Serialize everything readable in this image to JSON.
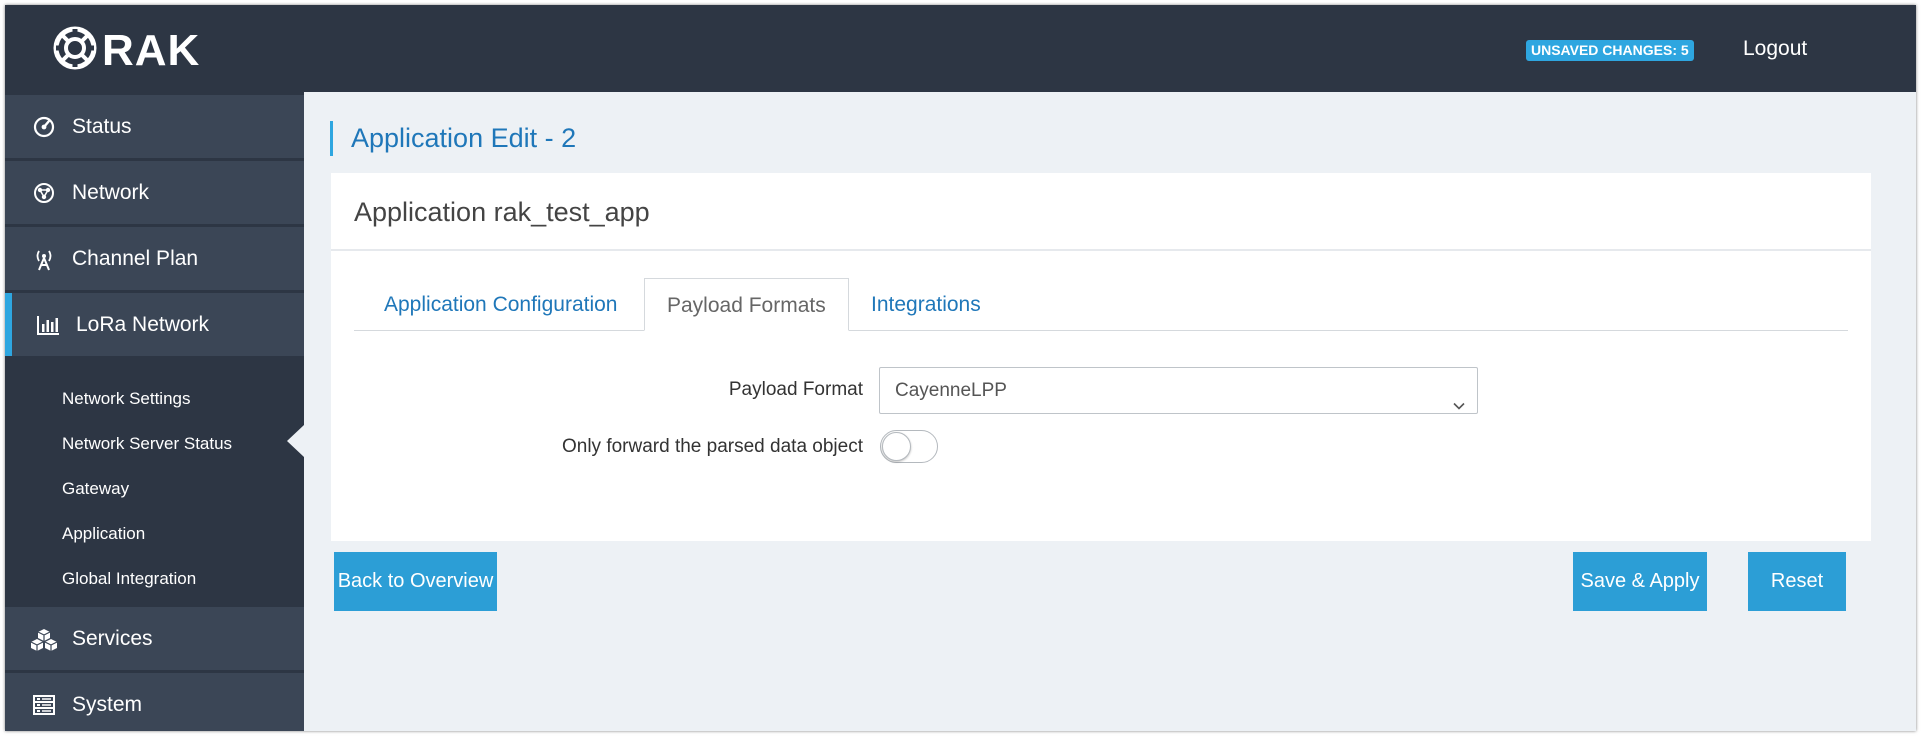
{
  "header": {
    "logo_text": "RAK",
    "unsaved_badge": "UNSAVED CHANGES: 5",
    "logout_label": "Logout"
  },
  "sidebar": {
    "items": [
      {
        "label": "Status",
        "icon": "dashboard-icon"
      },
      {
        "label": "Network",
        "icon": "network-icon"
      },
      {
        "label": "Channel Plan",
        "icon": "antenna-icon"
      },
      {
        "label": "LoRa Network",
        "icon": "bar-chart-icon",
        "active": true
      },
      {
        "label": "Services",
        "icon": "cubes-icon"
      },
      {
        "label": "System",
        "icon": "server-list-icon"
      }
    ],
    "sub_items": [
      {
        "label": "Network Settings"
      },
      {
        "label": "Network Server Status"
      },
      {
        "label": "Gateway"
      },
      {
        "label": "Application",
        "active": true
      },
      {
        "label": "Global Integration"
      }
    ]
  },
  "main": {
    "page_title": "Application Edit - 2",
    "card_title": "Application rak_test_app",
    "tabs": [
      {
        "label": "Application Configuration"
      },
      {
        "label": "Payload Formats",
        "active": true
      },
      {
        "label": "Integrations"
      }
    ],
    "form": {
      "payload_format_label": "Payload Format",
      "payload_format_value": "CayenneLPP",
      "forward_label": "Only forward the parsed data object",
      "forward_enabled": false
    },
    "buttons": {
      "back": "Back to Overview",
      "save": "Save & Apply",
      "reset": "Reset"
    }
  },
  "colors": {
    "header_bg": "#2d3644",
    "sidebar_item_bg": "#3b4656",
    "accent": "#2ea6e0",
    "button": "#2c9ed6",
    "link": "#1f77b9",
    "content_bg": "#edf1f5"
  }
}
